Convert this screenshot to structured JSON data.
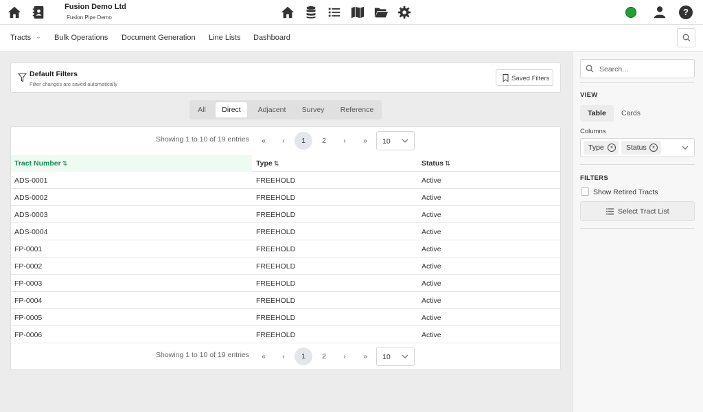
{
  "header": {
    "org_name": "Fusion Demo Ltd",
    "project_name": "Fusion Pipe Demo",
    "left_icons": [
      "home-icon",
      "contacts-icon"
    ],
    "center_icons": [
      "home-icon",
      "database-icon",
      "list-icon",
      "map-icon",
      "folder-icon",
      "gear-icon"
    ],
    "status_color": "#1fa22e",
    "help_label": "?"
  },
  "nav": {
    "items": [
      "Tracts",
      "Bulk Operations",
      "Document Generation",
      "Line Lists",
      "Dashboard"
    ],
    "dropdown_marker": "⌄"
  },
  "filters": {
    "title": "Default Filters",
    "subtitle": "Filter changes are saved automatically",
    "saved_label": "Saved Filters"
  },
  "tabs": {
    "items": [
      "All",
      "Direct",
      "Adjacent",
      "Survey",
      "Reference"
    ],
    "active": "Direct"
  },
  "pager": {
    "info": "Showing 1 to 10 of 19 entries",
    "first": "«",
    "prev": "‹",
    "pages": [
      "1",
      "2"
    ],
    "active_page": "1",
    "next": "›",
    "last": "»",
    "page_size": "10"
  },
  "table": {
    "columns": [
      "Tract Number",
      "Type",
      "Status"
    ],
    "sorted_column": "Tract Number",
    "sort_marker": "⇅",
    "rows": [
      [
        "ADS-0001",
        "FREEHOLD",
        "Active"
      ],
      [
        "ADS-0002",
        "FREEHOLD",
        "Active"
      ],
      [
        "ADS-0003",
        "FREEHOLD",
        "Active"
      ],
      [
        "ADS-0004",
        "FREEHOLD",
        "Active"
      ],
      [
        "FP-0001",
        "FREEHOLD",
        "Active"
      ],
      [
        "FP-0002",
        "FREEHOLD",
        "Active"
      ],
      [
        "FP-0003",
        "FREEHOLD",
        "Active"
      ],
      [
        "FP-0004",
        "FREEHOLD",
        "Active"
      ],
      [
        "FP-0005",
        "FREEHOLD",
        "Active"
      ],
      [
        "FP-0006",
        "FREEHOLD",
        "Active"
      ]
    ]
  },
  "sidebar": {
    "search_placeholder": "Search...",
    "view_heading": "VIEW",
    "view_options": [
      "Table",
      "Cards"
    ],
    "view_active": "Table",
    "columns_label": "Columns",
    "column_chips": [
      "Type",
      "Status"
    ],
    "chip_remove": "×",
    "filters_heading": "FILTERS",
    "show_retired_label": "Show Retired Tracts",
    "select_list_label": "Select Tract List"
  }
}
